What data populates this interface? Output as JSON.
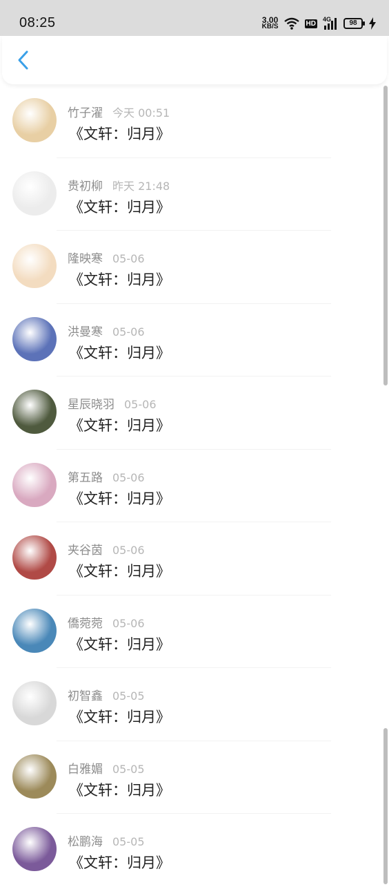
{
  "status_bar": {
    "time": "08:25",
    "speed_value": "3.00",
    "speed_unit": "KB/S",
    "hd": "HD",
    "network": "4G",
    "battery": "98"
  },
  "header": {
    "back_icon": "chevron-left-icon"
  },
  "messages": [
    {
      "name": "竹子濯",
      "time": "今天 00:51",
      "text": "《文轩：归月》",
      "avatar_color": "#e8cfa4"
    },
    {
      "name": "贵初柳",
      "time": "昨天 21:48",
      "text": "《文轩：归月》",
      "avatar_color": "#ececec"
    },
    {
      "name": "隆映寒",
      "time": "05-06",
      "text": "《文轩：归月》",
      "avatar_color": "#f3dcc0"
    },
    {
      "name": "洪曼寒",
      "time": "05-06",
      "text": "《文轩：归月》",
      "avatar_color": "#5c72b8"
    },
    {
      "name": "星辰晓羽",
      "time": "05-06",
      "text": "《文轩：归月》",
      "avatar_color": "#4f5a3e"
    },
    {
      "name": "第五路",
      "time": "05-06",
      "text": "《文轩：归月》",
      "avatar_color": "#d9a9c0"
    },
    {
      "name": "夹谷茵",
      "time": "05-06",
      "text": "《文轩：归月》",
      "avatar_color": "#b04a46"
    },
    {
      "name": "僑菀菀",
      "time": "05-06",
      "text": "《文轩：归月》",
      "avatar_color": "#4a88b8"
    },
    {
      "name": "初智鑫",
      "time": "05-05",
      "text": "《文轩：归月》",
      "avatar_color": "#d8d8d8"
    },
    {
      "name": "白雅媚",
      "time": "05-05",
      "text": "《文轩：归月》",
      "avatar_color": "#9c8a5a"
    },
    {
      "name": "松鹏海",
      "time": "05-05",
      "text": "《文轩：归月》",
      "avatar_color": "#7b5a9a"
    }
  ]
}
